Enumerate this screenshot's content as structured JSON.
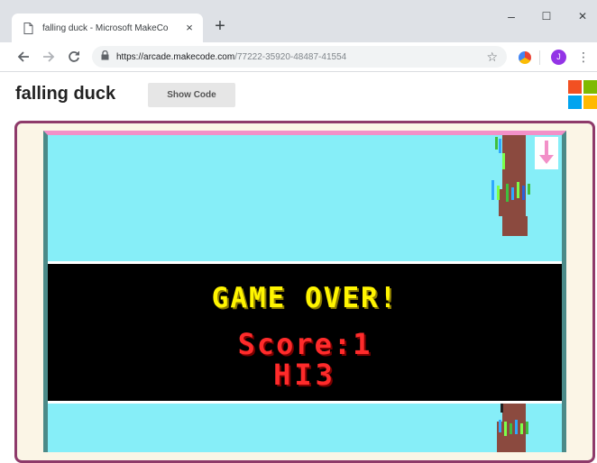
{
  "browser": {
    "tab_title": "falling duck - Microsoft MakeCo",
    "tab_close": "×",
    "new_tab": "+",
    "window_minimize": "–",
    "window_maximize": "☐",
    "window_close": "✕",
    "url_host": "https://arcade.makecode.com",
    "url_path": "/77222-35920-48487-41554",
    "bookmark_star": "☆",
    "profile_initial": "J",
    "menu": "⋮"
  },
  "page": {
    "title": "falling duck",
    "show_code_label": "Show Code"
  },
  "game": {
    "game_over_text": "GAME OVER!",
    "score_text": "Score:1",
    "hi_text": "HI3",
    "colors": {
      "sky": "#86eef8",
      "banner": "#000000",
      "game_over": "#fff500",
      "score": "#ff2b2b",
      "trunk": "#8b4a3f",
      "frame_border": "#8e3a6a",
      "frame_bg": "#fbf5e6"
    }
  },
  "icons": {
    "page": "page-icon",
    "back": "back-arrow-icon",
    "forward": "forward-arrow-icon",
    "reload": "reload-icon",
    "lock": "lock-icon",
    "star": "star-icon",
    "extension": "extension-icon",
    "microsoft": "microsoft-logo-icon"
  }
}
